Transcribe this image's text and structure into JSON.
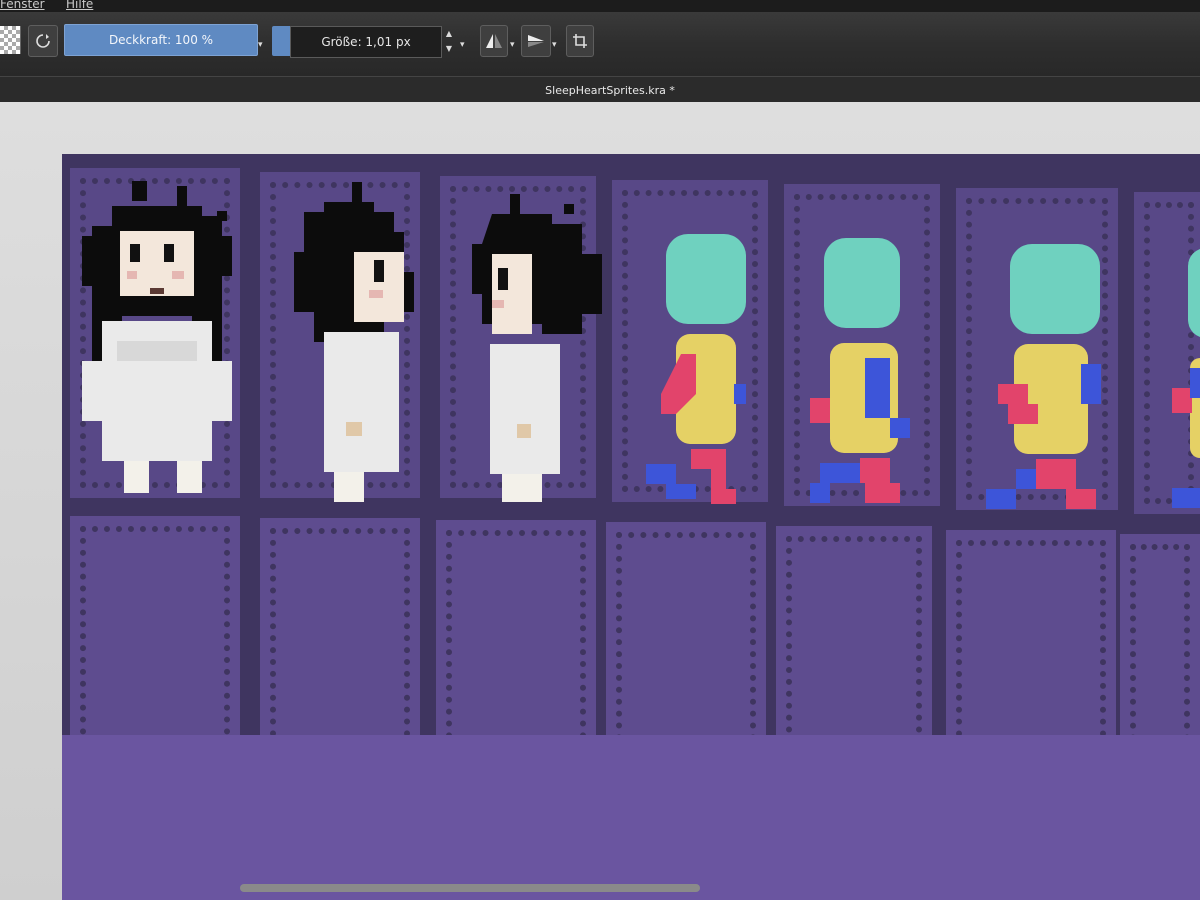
{
  "menu": {
    "items": [
      "Fenster",
      "Hilfe"
    ]
  },
  "toolbar": {
    "opacity_label": "Deckkraft: 100 %",
    "size_label": "Größe: 1,01 px"
  },
  "document": {
    "title": "SleepHeartSprites.kra *"
  },
  "colors": {
    "canvas_bg": "#3f3560",
    "frame": "#584887",
    "hair": "#0c0c0c",
    "skin": "#f3e7db",
    "dress": "#eaeaea",
    "head_placeholder": "#6fd1bf",
    "body_placeholder": "#e5d165",
    "limb_pink": "#e2446b",
    "limb_blue": "#3d55d9"
  },
  "icons": [
    "checker-icon",
    "refresh-icon",
    "mirror-horizontal-icon",
    "mirror-vertical-icon",
    "crop-icon"
  ]
}
